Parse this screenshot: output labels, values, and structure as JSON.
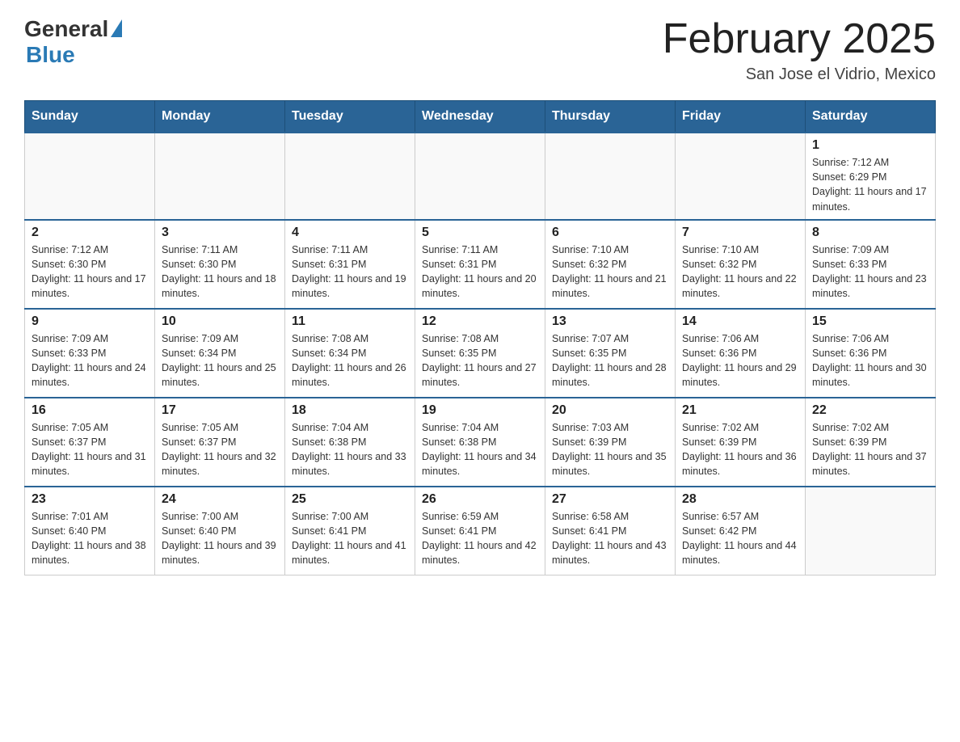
{
  "logo": {
    "general": "General",
    "blue": "Blue"
  },
  "title": "February 2025",
  "subtitle": "San Jose el Vidrio, Mexico",
  "days_of_week": [
    "Sunday",
    "Monday",
    "Tuesday",
    "Wednesday",
    "Thursday",
    "Friday",
    "Saturday"
  ],
  "weeks": [
    [
      {
        "day": "",
        "info": ""
      },
      {
        "day": "",
        "info": ""
      },
      {
        "day": "",
        "info": ""
      },
      {
        "day": "",
        "info": ""
      },
      {
        "day": "",
        "info": ""
      },
      {
        "day": "",
        "info": ""
      },
      {
        "day": "1",
        "info": "Sunrise: 7:12 AM\nSunset: 6:29 PM\nDaylight: 11 hours and 17 minutes."
      }
    ],
    [
      {
        "day": "2",
        "info": "Sunrise: 7:12 AM\nSunset: 6:30 PM\nDaylight: 11 hours and 17 minutes."
      },
      {
        "day": "3",
        "info": "Sunrise: 7:11 AM\nSunset: 6:30 PM\nDaylight: 11 hours and 18 minutes."
      },
      {
        "day": "4",
        "info": "Sunrise: 7:11 AM\nSunset: 6:31 PM\nDaylight: 11 hours and 19 minutes."
      },
      {
        "day": "5",
        "info": "Sunrise: 7:11 AM\nSunset: 6:31 PM\nDaylight: 11 hours and 20 minutes."
      },
      {
        "day": "6",
        "info": "Sunrise: 7:10 AM\nSunset: 6:32 PM\nDaylight: 11 hours and 21 minutes."
      },
      {
        "day": "7",
        "info": "Sunrise: 7:10 AM\nSunset: 6:32 PM\nDaylight: 11 hours and 22 minutes."
      },
      {
        "day": "8",
        "info": "Sunrise: 7:09 AM\nSunset: 6:33 PM\nDaylight: 11 hours and 23 minutes."
      }
    ],
    [
      {
        "day": "9",
        "info": "Sunrise: 7:09 AM\nSunset: 6:33 PM\nDaylight: 11 hours and 24 minutes."
      },
      {
        "day": "10",
        "info": "Sunrise: 7:09 AM\nSunset: 6:34 PM\nDaylight: 11 hours and 25 minutes."
      },
      {
        "day": "11",
        "info": "Sunrise: 7:08 AM\nSunset: 6:34 PM\nDaylight: 11 hours and 26 minutes."
      },
      {
        "day": "12",
        "info": "Sunrise: 7:08 AM\nSunset: 6:35 PM\nDaylight: 11 hours and 27 minutes."
      },
      {
        "day": "13",
        "info": "Sunrise: 7:07 AM\nSunset: 6:35 PM\nDaylight: 11 hours and 28 minutes."
      },
      {
        "day": "14",
        "info": "Sunrise: 7:06 AM\nSunset: 6:36 PM\nDaylight: 11 hours and 29 minutes."
      },
      {
        "day": "15",
        "info": "Sunrise: 7:06 AM\nSunset: 6:36 PM\nDaylight: 11 hours and 30 minutes."
      }
    ],
    [
      {
        "day": "16",
        "info": "Sunrise: 7:05 AM\nSunset: 6:37 PM\nDaylight: 11 hours and 31 minutes."
      },
      {
        "day": "17",
        "info": "Sunrise: 7:05 AM\nSunset: 6:37 PM\nDaylight: 11 hours and 32 minutes."
      },
      {
        "day": "18",
        "info": "Sunrise: 7:04 AM\nSunset: 6:38 PM\nDaylight: 11 hours and 33 minutes."
      },
      {
        "day": "19",
        "info": "Sunrise: 7:04 AM\nSunset: 6:38 PM\nDaylight: 11 hours and 34 minutes."
      },
      {
        "day": "20",
        "info": "Sunrise: 7:03 AM\nSunset: 6:39 PM\nDaylight: 11 hours and 35 minutes."
      },
      {
        "day": "21",
        "info": "Sunrise: 7:02 AM\nSunset: 6:39 PM\nDaylight: 11 hours and 36 minutes."
      },
      {
        "day": "22",
        "info": "Sunrise: 7:02 AM\nSunset: 6:39 PM\nDaylight: 11 hours and 37 minutes."
      }
    ],
    [
      {
        "day": "23",
        "info": "Sunrise: 7:01 AM\nSunset: 6:40 PM\nDaylight: 11 hours and 38 minutes."
      },
      {
        "day": "24",
        "info": "Sunrise: 7:00 AM\nSunset: 6:40 PM\nDaylight: 11 hours and 39 minutes."
      },
      {
        "day": "25",
        "info": "Sunrise: 7:00 AM\nSunset: 6:41 PM\nDaylight: 11 hours and 41 minutes."
      },
      {
        "day": "26",
        "info": "Sunrise: 6:59 AM\nSunset: 6:41 PM\nDaylight: 11 hours and 42 minutes."
      },
      {
        "day": "27",
        "info": "Sunrise: 6:58 AM\nSunset: 6:41 PM\nDaylight: 11 hours and 43 minutes."
      },
      {
        "day": "28",
        "info": "Sunrise: 6:57 AM\nSunset: 6:42 PM\nDaylight: 11 hours and 44 minutes."
      },
      {
        "day": "",
        "info": ""
      }
    ]
  ]
}
